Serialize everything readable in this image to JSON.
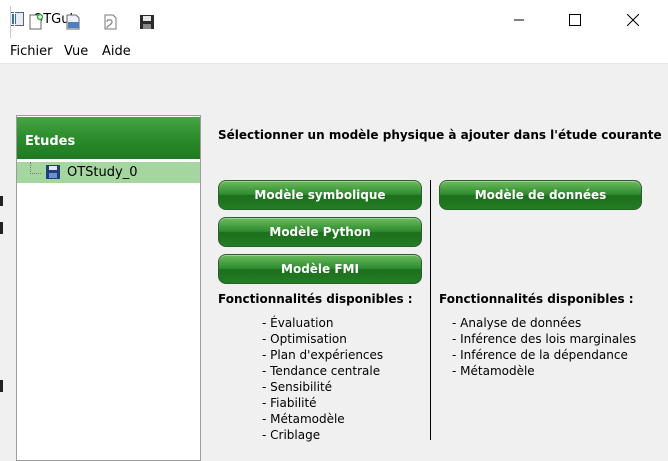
{
  "window": {
    "title": "OTGui"
  },
  "menu": {
    "items": [
      "Fichier",
      "Vue",
      "Aide"
    ]
  },
  "toolbar": {
    "buttons": [
      "new-study-icon",
      "open-study-icon",
      "import-python-icon",
      "save-icon"
    ]
  },
  "studies": {
    "header": "Etudes",
    "items": [
      {
        "label": "OTStudy_0"
      }
    ]
  },
  "main": {
    "heading": "Sélectionner un modèle physique à ajouter dans l'étude courante",
    "left": {
      "buttons": [
        "Modèle symbolique",
        "Modèle Python",
        "Modèle FMI"
      ],
      "features_title": "Fonctionnalités disponibles :",
      "features": [
        "- Évaluation",
        "- Optimisation",
        "- Plan d'expériences",
        "- Tendance centrale",
        "- Sensibilité",
        "- Fiabilité",
        "- Métamodèle",
        "- Criblage"
      ]
    },
    "right": {
      "buttons": [
        "Modèle de données"
      ],
      "features_title": "Fonctionnalités disponibles :",
      "features": [
        "- Analyse de données",
        "- Inférence des lois marginales",
        "- Inférence de la dépendance",
        "- Métamodèle"
      ]
    }
  },
  "colors": {
    "accent_green": "#2e8a2e",
    "selection_green": "#a5d6a0"
  }
}
